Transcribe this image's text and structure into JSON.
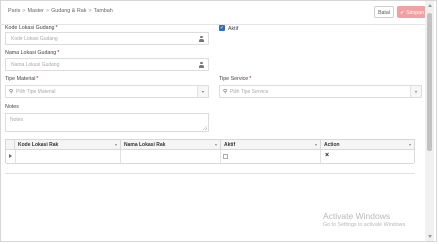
{
  "breadcrumb": [
    "Paris",
    "Master",
    "Gudang & Rak",
    "Tambah"
  ],
  "toolbar": {
    "batal_label": "Batal",
    "simpan_label": "Simpan",
    "simpan_color": "#f2a0a3"
  },
  "form": {
    "kode": {
      "label": "Kode Lokasi Gudang",
      "required": "*",
      "placeholder": "Kode Lokasi Gudang"
    },
    "aktif": {
      "label": "Aktif",
      "checked": true
    },
    "nama": {
      "label": "Nama Lokasi Gudang",
      "required": "*",
      "placeholder": "Nama Lokasi Gudang"
    },
    "tipe_material": {
      "label": "Tipe Material",
      "required": "*",
      "placeholder": "Pilih Tipe Material"
    },
    "tipe_service": {
      "label": "Tipe Service",
      "required": "*",
      "placeholder": "Pilih Tipe Service"
    },
    "notes": {
      "label": "Notes",
      "placeholder": "Notes"
    }
  },
  "grid": {
    "columns": [
      "Kode Lokasi Rak",
      "Nama Lokasi Rak",
      "Aktif",
      "Action"
    ],
    "rows": [
      {
        "kode": "",
        "nama": "",
        "aktif": false,
        "action_icon": "close-icon"
      }
    ]
  },
  "watermark": {
    "line1": "Activate Windows",
    "line2": "Go to Settings to activate Windows."
  },
  "icons": {
    "user": "user-icon",
    "search": "search-icon",
    "dropdown": "chevron-down-icon",
    "check": "check-icon"
  }
}
